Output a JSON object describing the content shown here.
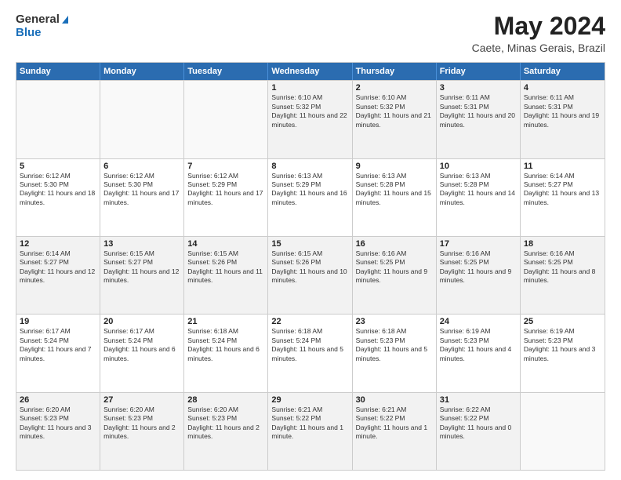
{
  "logo": {
    "line1": "General",
    "line2": "Blue"
  },
  "header": {
    "month": "May 2024",
    "location": "Caete, Minas Gerais, Brazil"
  },
  "weekdays": [
    "Sunday",
    "Monday",
    "Tuesday",
    "Wednesday",
    "Thursday",
    "Friday",
    "Saturday"
  ],
  "rows": [
    [
      {
        "day": "",
        "empty": true
      },
      {
        "day": "",
        "empty": true
      },
      {
        "day": "",
        "empty": true
      },
      {
        "day": "1",
        "sunrise": "6:10 AM",
        "sunset": "5:32 PM",
        "daylight": "11 hours and 22 minutes."
      },
      {
        "day": "2",
        "sunrise": "6:10 AM",
        "sunset": "5:32 PM",
        "daylight": "11 hours and 21 minutes."
      },
      {
        "day": "3",
        "sunrise": "6:11 AM",
        "sunset": "5:31 PM",
        "daylight": "11 hours and 20 minutes."
      },
      {
        "day": "4",
        "sunrise": "6:11 AM",
        "sunset": "5:31 PM",
        "daylight": "11 hours and 19 minutes."
      }
    ],
    [
      {
        "day": "5",
        "sunrise": "6:12 AM",
        "sunset": "5:30 PM",
        "daylight": "11 hours and 18 minutes."
      },
      {
        "day": "6",
        "sunrise": "6:12 AM",
        "sunset": "5:30 PM",
        "daylight": "11 hours and 17 minutes."
      },
      {
        "day": "7",
        "sunrise": "6:12 AM",
        "sunset": "5:29 PM",
        "daylight": "11 hours and 17 minutes."
      },
      {
        "day": "8",
        "sunrise": "6:13 AM",
        "sunset": "5:29 PM",
        "daylight": "11 hours and 16 minutes."
      },
      {
        "day": "9",
        "sunrise": "6:13 AM",
        "sunset": "5:28 PM",
        "daylight": "11 hours and 15 minutes."
      },
      {
        "day": "10",
        "sunrise": "6:13 AM",
        "sunset": "5:28 PM",
        "daylight": "11 hours and 14 minutes."
      },
      {
        "day": "11",
        "sunrise": "6:14 AM",
        "sunset": "5:27 PM",
        "daylight": "11 hours and 13 minutes."
      }
    ],
    [
      {
        "day": "12",
        "sunrise": "6:14 AM",
        "sunset": "5:27 PM",
        "daylight": "11 hours and 12 minutes."
      },
      {
        "day": "13",
        "sunrise": "6:15 AM",
        "sunset": "5:27 PM",
        "daylight": "11 hours and 12 minutes."
      },
      {
        "day": "14",
        "sunrise": "6:15 AM",
        "sunset": "5:26 PM",
        "daylight": "11 hours and 11 minutes."
      },
      {
        "day": "15",
        "sunrise": "6:15 AM",
        "sunset": "5:26 PM",
        "daylight": "11 hours and 10 minutes."
      },
      {
        "day": "16",
        "sunrise": "6:16 AM",
        "sunset": "5:25 PM",
        "daylight": "11 hours and 9 minutes."
      },
      {
        "day": "17",
        "sunrise": "6:16 AM",
        "sunset": "5:25 PM",
        "daylight": "11 hours and 9 minutes."
      },
      {
        "day": "18",
        "sunrise": "6:16 AM",
        "sunset": "5:25 PM",
        "daylight": "11 hours and 8 minutes."
      }
    ],
    [
      {
        "day": "19",
        "sunrise": "6:17 AM",
        "sunset": "5:24 PM",
        "daylight": "11 hours and 7 minutes."
      },
      {
        "day": "20",
        "sunrise": "6:17 AM",
        "sunset": "5:24 PM",
        "daylight": "11 hours and 6 minutes."
      },
      {
        "day": "21",
        "sunrise": "6:18 AM",
        "sunset": "5:24 PM",
        "daylight": "11 hours and 6 minutes."
      },
      {
        "day": "22",
        "sunrise": "6:18 AM",
        "sunset": "5:24 PM",
        "daylight": "11 hours and 5 minutes."
      },
      {
        "day": "23",
        "sunrise": "6:18 AM",
        "sunset": "5:23 PM",
        "daylight": "11 hours and 5 minutes."
      },
      {
        "day": "24",
        "sunrise": "6:19 AM",
        "sunset": "5:23 PM",
        "daylight": "11 hours and 4 minutes."
      },
      {
        "day": "25",
        "sunrise": "6:19 AM",
        "sunset": "5:23 PM",
        "daylight": "11 hours and 3 minutes."
      }
    ],
    [
      {
        "day": "26",
        "sunrise": "6:20 AM",
        "sunset": "5:23 PM",
        "daylight": "11 hours and 3 minutes."
      },
      {
        "day": "27",
        "sunrise": "6:20 AM",
        "sunset": "5:23 PM",
        "daylight": "11 hours and 2 minutes."
      },
      {
        "day": "28",
        "sunrise": "6:20 AM",
        "sunset": "5:23 PM",
        "daylight": "11 hours and 2 minutes."
      },
      {
        "day": "29",
        "sunrise": "6:21 AM",
        "sunset": "5:22 PM",
        "daylight": "11 hours and 1 minute."
      },
      {
        "day": "30",
        "sunrise": "6:21 AM",
        "sunset": "5:22 PM",
        "daylight": "11 hours and 1 minute."
      },
      {
        "day": "31",
        "sunrise": "6:22 AM",
        "sunset": "5:22 PM",
        "daylight": "11 hours and 0 minutes."
      },
      {
        "day": "",
        "empty": true
      }
    ]
  ],
  "labels": {
    "sunrise": "Sunrise:",
    "sunset": "Sunset:",
    "daylight": "Daylight:"
  }
}
